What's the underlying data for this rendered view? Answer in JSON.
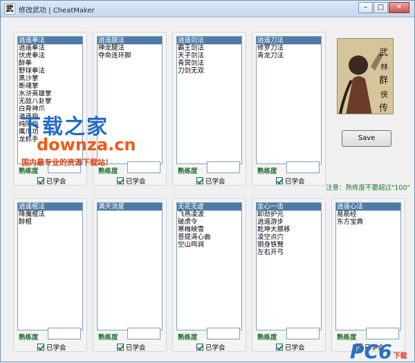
{
  "window": {
    "title": "修改武功 | CheatMaker",
    "icon_glyph": "武",
    "controls": [
      "–",
      "□",
      "✕"
    ]
  },
  "groups": [
    {
      "items": [
        "逍遥拳法",
        "逍遥拳法",
        "伏虎拳法",
        "醉拳",
        "野球拳法",
        "黑沙掌",
        "断魂掌",
        "水浒英雄掌",
        "无敌八卦掌",
        "白骨神爪",
        "逍遥指",
        "纯阳指",
        "鹰爪功",
        "龙抓手"
      ],
      "selected": 0,
      "prof_label": "熟练度",
      "prof_value": "",
      "learned_label": "已学会"
    },
    {
      "items": [
        "逍遥腿法",
        "神龙腿法",
        "夺命连环脚"
      ],
      "selected": 0,
      "prof_label": "熟练度",
      "prof_value": "",
      "learned_label": "已学会"
    },
    {
      "items": [
        "逍遥剑法",
        "霸王剑法",
        "天子剑法",
        "青冥剑法",
        "刀剑无双"
      ],
      "selected": 0,
      "prof_label": "熟练度",
      "prof_value": "",
      "learned_label": "已学会"
    },
    {
      "items": [
        "逍遥刀法",
        "修罗刀法",
        "青龙刀法"
      ],
      "selected": 0,
      "prof_label": "熟练度",
      "prof_value": "",
      "learned_label": "已学会"
    },
    {
      "items": [
        "逍遥棍法",
        "降魔棍法",
        "醉棍"
      ],
      "selected": 0,
      "prof_label": "熟练度",
      "prof_value": "",
      "learned_label": "已学会"
    },
    {
      "items": [
        "满天流星"
      ],
      "selected": 0,
      "prof_label": "熟练度",
      "prof_value": "",
      "learned_label": "已学会"
    },
    {
      "items": [
        "无花无虚",
        "飞燕凌波",
        "破虏令",
        "寒梅映雪",
        "菩提清心曲",
        "空山鸣涧"
      ],
      "selected": 0,
      "prof_label": "熟练度",
      "prof_value": "",
      "learned_label": "已学会"
    },
    {
      "items": [
        "金心一击",
        "卸劲护元",
        "逍遥游步",
        "乾坤大挪移",
        "凌空点穴",
        "铜身铁臂",
        "左右开弓"
      ],
      "selected": 0,
      "prof_label": "熟练度",
      "prof_value": "",
      "learned_label": "已学会"
    },
    {
      "items": [
        "逍遥心法",
        "易筋经",
        "东方宝典"
      ],
      "selected": 0,
      "prof_label": "熟练度",
      "prof_value": "",
      "learned_label": "已学会"
    }
  ],
  "save_label": "Save",
  "note": "注意：熟练度不要超过\"100\"",
  "watermark": {
    "line1": "下载之家",
    "line2": "downza.cn",
    "line3": "国内最专业的资源下载站！",
    "corner": "PC6",
    "corner_sub": "下载"
  },
  "colors": {
    "selection": "#4d7aa6",
    "label_green": "#1f6f2a"
  }
}
